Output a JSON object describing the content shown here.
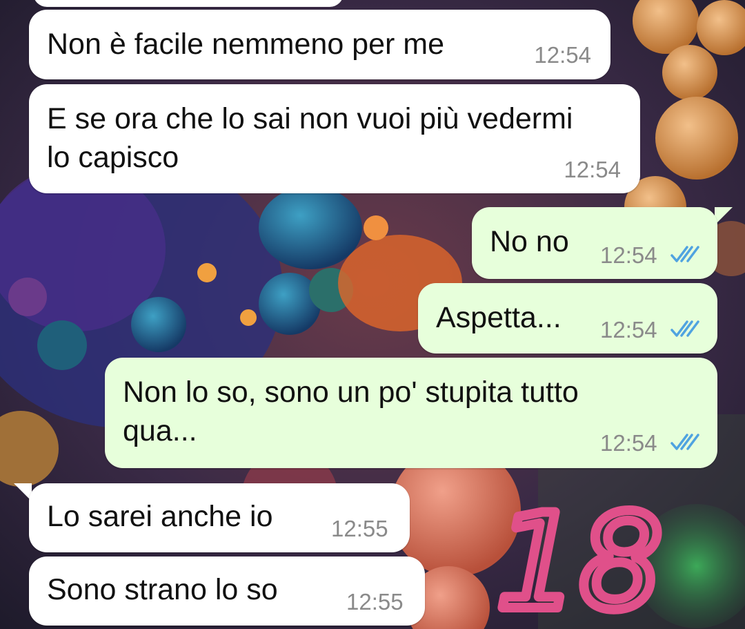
{
  "messages": [
    {
      "direction": "in",
      "text": "Non è facile nemmeno per me",
      "time": "12:54"
    },
    {
      "direction": "in",
      "text": "E se ora che lo sai non vuoi più vedermi\nlo capisco",
      "time": "12:54"
    },
    {
      "direction": "out",
      "text": "No no",
      "time": "12:54",
      "status": "read"
    },
    {
      "direction": "out",
      "text": "Aspetta...",
      "time": "12:54",
      "status": "read"
    },
    {
      "direction": "out",
      "text": "Non lo so, sono un po' stupita tutto\nqua...",
      "time": "12:54",
      "status": "read"
    },
    {
      "direction": "in",
      "text": "Lo sarei anche io",
      "time": "12:55"
    },
    {
      "direction": "in",
      "text": "Sono strano lo so",
      "time": "12:55"
    }
  ],
  "overlay_number": "18",
  "colors": {
    "incoming_bubble": "#ffffff",
    "outgoing_bubble": "#e7ffdb",
    "read_ticks": "#4fa3e0",
    "overlay_number": "#e0508a"
  },
  "icons": {
    "read_status": "double-check-icon"
  }
}
